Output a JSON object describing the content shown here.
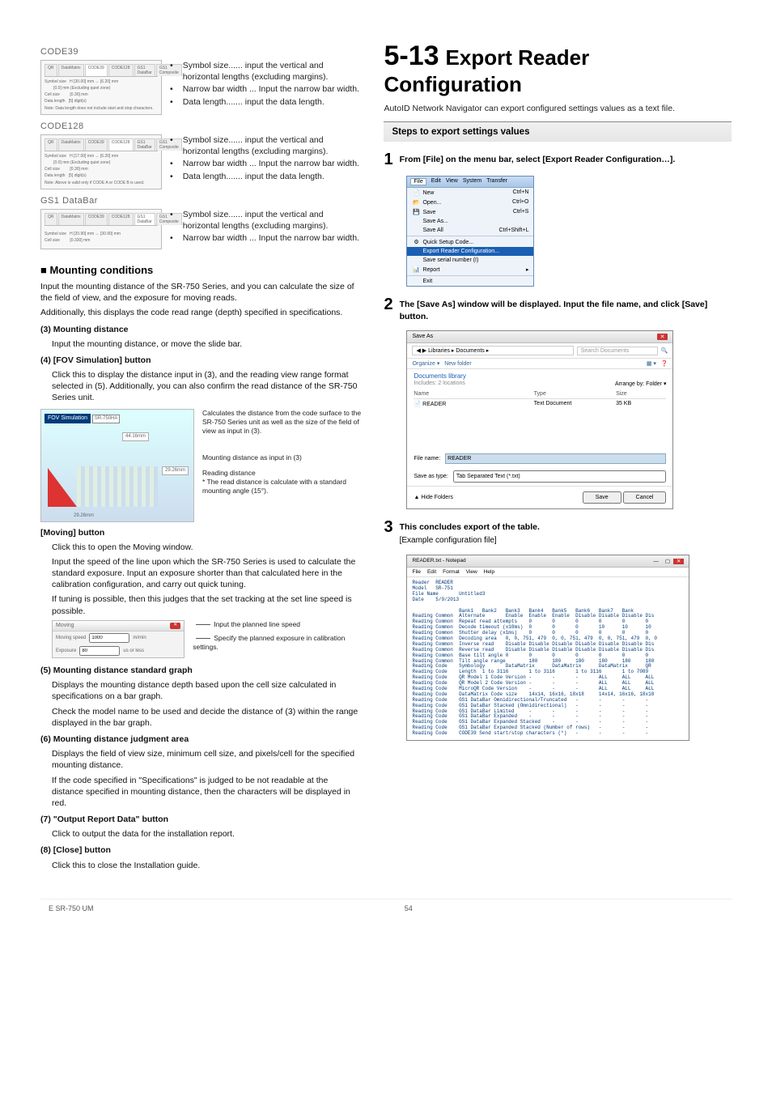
{
  "left": {
    "code39": {
      "title": "CODE39",
      "fig_tabs": [
        "QR",
        "DataMatrix",
        "CODE39",
        "CODE128",
        "GS1 DataBar",
        "GS1 Composite"
      ],
      "fig_note": "Note: Data length does not include start and stop characters.",
      "bullets": [
        "Symbol size...... input the vertical and horizontal lengths (excluding margins).",
        "Narrow bar width ... Input the narrow bar width.",
        "Data length....... input the data length."
      ]
    },
    "code128": {
      "title": "CODE128",
      "fig_tabs": [
        "QR",
        "DataMatrix",
        "CODE39",
        "CODE128",
        "GS1 DataBar",
        "GS1 Composite"
      ],
      "fig_note": "Note: Above is valid only if CODE A or CODE B is used.",
      "bullets": [
        "Symbol size...... input the vertical and horizontal lengths (excluding margins).",
        "Narrow bar width ... Input the narrow bar width.",
        "Data length....... input the data length."
      ]
    },
    "gs1": {
      "title": "GS1 DataBar",
      "fig_tabs": [
        "QR",
        "DataMatrix",
        "CODE39",
        "CODE128",
        "GS1 DataBar",
        "GS1 Composite"
      ],
      "bullets": [
        "Symbol size...... input the vertical and horizontal lengths (excluding margins).",
        "Narrow bar width ... Input the narrow bar width."
      ]
    },
    "mounting": {
      "heading": "Mounting conditions",
      "p1": "Input the mounting distance of the SR-750 Series, and you can calculate the size of the field of view, and the exposure for moving reads.",
      "p2": "Additionally, this displays the code read range (depth) specified in specifications.",
      "n3_title": "(3) Mounting distance",
      "n3_body": "Input the mounting distance, or move the slide bar.",
      "n4_title": "(4) [FOV Simulation] button",
      "n4_body": "Click this to display the distance input in (3), and the reading view range format selected in (5). Additionally, you can also confirm the read distance of the SR-750 Series unit.",
      "fov_fig": {
        "title": "FOV Simulation",
        "model": "SR-750HA",
        "w": "44.16mm",
        "h": "29.26mm",
        "bottom": "29.26mm"
      },
      "fov_anno": {
        "l1": "Calculates the distance from the code surface to the SR-750 Series unit as well as the size of the field of view as input in (3).",
        "l2": "Mounting distance as input in (3)",
        "l3": "Reading distance",
        "l3b": "* The read distance is calculate with a standard mounting angle (15°)."
      },
      "moving_title": "[Moving] button",
      "moving_p1": "Click this to open the Moving window.",
      "moving_p2": "Input the speed of the line upon which the SR-750 Series is used to calculate the standard exposure. Input an exposure shorter than that calculated here in the calibration configuration, and carry out quick tuning.",
      "moving_p3": "If tuning is possible, then this judges that the set tracking at the set line speed is possible.",
      "moving_fig": {
        "title": "Moving",
        "row1_label": "Moving speed",
        "row1_val": "1000",
        "row1_unit": "m/min",
        "row2_label": "Exposure",
        "row2_val": "80",
        "row2_unit": "us or less"
      },
      "moving_anno": {
        "a1": "Input the planned line speed",
        "a2": "Specify the planned exposure in calibration settings."
      },
      "n5_title": "(5) Mounting distance standard graph",
      "n5_body1": "Displays the mounting distance depth based upon the cell size calculated in specifications on a bar graph.",
      "n5_body2": "Check the model name to be used and decide the distance of (3) within the range displayed in the bar graph.",
      "n6_title": "(6) Mounting distance judgment area",
      "n6_body1": "Displays the field of view size, minimum cell size, and pixels/cell for the specified mounting distance.",
      "n6_body2": "If the code specified in \"Specifications\" is judged to be not readable at the distance specified in mounting distance, then the characters will be displayed in red.",
      "n7_title": "(7) \"Output Report Data\" button",
      "n7_body": "Click to output the data for the installation report.",
      "n8_title": "(8) [Close] button",
      "n8_body": "Click this to close the Installation guide."
    }
  },
  "right": {
    "h1_num": "5-13",
    "h1_txt": "Export Reader Configuration",
    "intro": "AutoID Network Navigator can export configured settings values as a text file.",
    "steps_title": "Steps to export settings values",
    "step1": {
      "n": "1",
      "t": "From [File] on the menu bar, select [Export Reader Configuration…]."
    },
    "menu": {
      "bar": [
        "File",
        "Edit",
        "View",
        "System",
        "Transfer"
      ],
      "items": [
        {
          "icon": "📄",
          "label": "New",
          "accel": "Ctrl+N"
        },
        {
          "icon": "📂",
          "label": "Open...",
          "accel": "Ctrl+O"
        },
        {
          "icon": "💾",
          "label": "Save",
          "accel": "Ctrl+S"
        },
        {
          "icon": "",
          "label": "Save As...",
          "accel": ""
        },
        {
          "icon": "",
          "label": "Save All",
          "accel": "Ctrl+Shift+L"
        }
      ],
      "sep1": true,
      "quick": {
        "icon": "⚙",
        "label": "Quick Setup Code..."
      },
      "export": "Export Reader Configuration...",
      "serial": "Save serial number (I)",
      "report": {
        "icon": "📊",
        "label": "Report",
        "arrow": "▸"
      },
      "exit": "Exit"
    },
    "step2": {
      "n": "2",
      "t": "The [Save As] window will be displayed. Input the file name, and click [Save] button."
    },
    "saveas": {
      "title": "Save As",
      "crumb": "◀ ▶ Libraries ▸ Documents ▸",
      "search_ph": "Search Documents",
      "organize": "Organize ▾",
      "newfolder": "New folder",
      "lib": "Documents library",
      "sub": "Includes: 2 locations",
      "arrange": "Arrange by:   Folder ▾",
      "col_name": "Name",
      "col_type": "Type",
      "col_size": "Size",
      "row_name": "READER",
      "row_type": "Text Document",
      "row_size": "35 KB",
      "fn_label": "File name:",
      "fn_value": "READER",
      "type_label": "Save as type:",
      "type_value": "Tab Separated Text (*.txt)",
      "hide": "Hide Folders",
      "save_btn": "Save",
      "cancel_btn": "Cancel"
    },
    "step3": {
      "n": "3",
      "t": "This concludes export of the table.",
      "sub": "[Example configuration file]"
    },
    "notepad": {
      "title": "READER.txt - Notepad",
      "menubar": [
        "File",
        "Edit",
        "Format",
        "View",
        "Help"
      ],
      "content": "Reader  READER\nModel   SR-751\nFile Name       Untitled3\nDate    5/9/2013\n\n                Bank1   Bank2   Bank3   Bank4   Bank5   Bank6   Bank7   Bank\nReading Common  Alternate       Enable  Enable  Enable  Disable Disable Disable Dis\nReading Common  Repeat read attempts    0       0       0       0       0       0\nReading Common  Decode timeout (x10ms)  0       0       0       10      10      10\nReading Common  Shutter delay (x1ms)    0       0       0       0       0       0\nReading Common  Decoding area   0, 0, 751, 479  0, 0, 751, 479  0, 0, 751, 479  0, 0\nReading Common  Inverse read    Disable Disable Disable Disable Disable Disable Dis\nReading Common  Reverse read    Disable Disable Disable Disable Disable Disable Dis\nReading Common  Base tilt angle 0       0       0       0       0       0       0\nReading Common  Tilt angle range        180     180     180     180     180     180\nReading Code    Symbology       DataMatrix      DataMatrix      DataMatrix      QR\nReading Code    Length  1 to 3116       1 to 3116       1 to 3116       1 to 7089\nReading Code    QR Model 1 Code Version -       -       -       ALL     ALL     ALL\nReading Code    QR Model 2 Code Version -       -       -       ALL     ALL     ALL\nReading Code    MicroQR Code Version    -       -       -       ALL     ALL     ALL\nReading Code    DataMatrix Code size    14x14, 16x16, 18x18     14x14, 16x16, 18x18\nReading Code    GS1 DataBar Omnidirectional/Truncated   -       -       -       -\nReading Code    GS1 DataBar Stacked (Omnidirectional)   -       -       -       -\nReading Code    GS1 DataBar Limited     -       -       -       -       -       -\nReading Code    GS1 DataBar Expanded    -       -       -       -       -       -\nReading Code    GS1 DataBar Expanded Stacked    -       -       -       -       -\nReading Code    GS1 DataBar Expanded Stacked (Number of rows)   -       -       -\nReading Code    CODE39 Send start/stop characters (*)   -       -       -       -"
    }
  },
  "footer": {
    "left": "E SR-750 UM",
    "page": "54"
  }
}
